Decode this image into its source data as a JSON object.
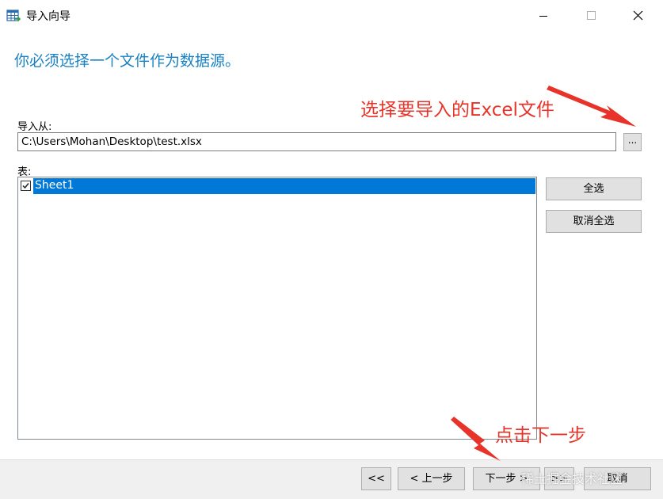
{
  "window": {
    "title": "导入向导",
    "heading": "你必须选择一个文件作为数据源。"
  },
  "source": {
    "label": "导入从:",
    "path": "C:\\Users\\Mohan\\Desktop\\test.xlsx",
    "browse_label": "..."
  },
  "tables": {
    "label": "表:",
    "items": [
      {
        "name": "Sheet1",
        "checked": true,
        "selected": true
      }
    ],
    "select_all": "全选",
    "deselect_all": "取消全选"
  },
  "footer": {
    "first": "<<",
    "prev": "< 上一步",
    "next": "下一步 >",
    "last": ">>",
    "cancel": "取消"
  },
  "annotations": {
    "choose_file": "选择要导入的Excel文件",
    "click_next": "点击下一步",
    "color": "#e8332a"
  },
  "watermark": "稀土掘金技术社区",
  "colors": {
    "accent": "#1a82c4",
    "selection": "#0078d7"
  }
}
